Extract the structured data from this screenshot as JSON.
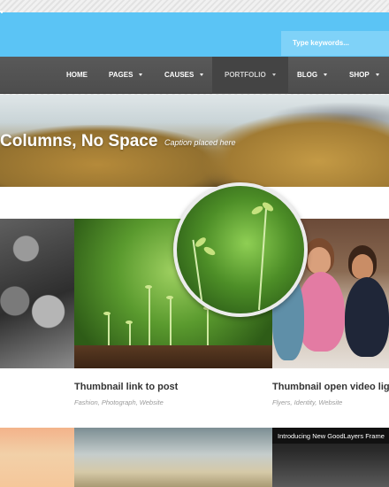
{
  "search": {
    "placeholder": "Type keywords..."
  },
  "nav": {
    "items": [
      {
        "label": "Home",
        "has_dropdown": false,
        "active": false
      },
      {
        "label": "Pages",
        "has_dropdown": true,
        "active": false
      },
      {
        "label": "Causes",
        "has_dropdown": true,
        "active": false
      },
      {
        "label": "Portfolio",
        "has_dropdown": true,
        "active": true
      },
      {
        "label": "Blog",
        "has_dropdown": true,
        "active": false
      },
      {
        "label": "Shop",
        "has_dropdown": true,
        "active": false
      }
    ]
  },
  "hero": {
    "title": "Columns, No Space",
    "caption": "Caption placed here"
  },
  "portfolio": {
    "items": [
      {
        "title": "Thumbnail link to post",
        "tags": "Fashion, Photograph, Website"
      },
      {
        "title": "Thumbnail open video lig",
        "tags": "Flyers, Identity, Website"
      }
    ],
    "video_title": "Introducing New GoodLayers Frame"
  },
  "colors": {
    "topbar": "#5bc4f5",
    "navbar": "#555555",
    "nav_active": "#444444"
  }
}
